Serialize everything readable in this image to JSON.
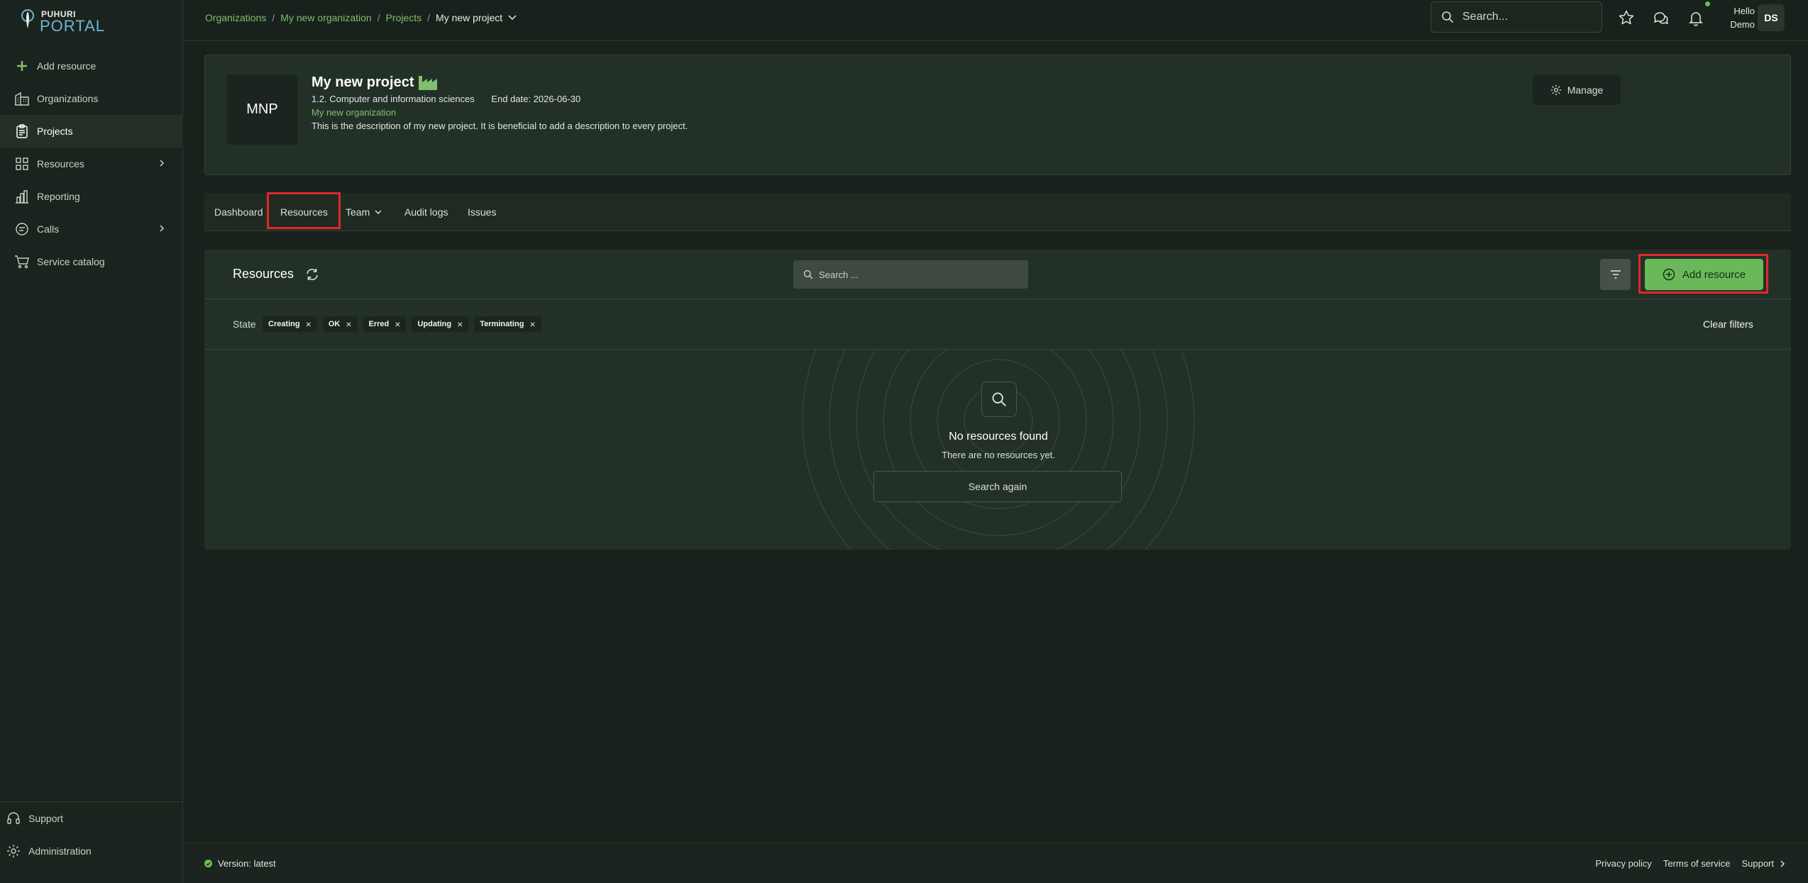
{
  "brand": {
    "top": "PUHURI",
    "bottom": "PORTAL"
  },
  "sidebar": {
    "items": [
      {
        "label": "Add resource",
        "icon": "plus-icon"
      },
      {
        "label": "Organizations",
        "icon": "building-icon"
      },
      {
        "label": "Projects",
        "icon": "clipboard-icon",
        "active": true
      },
      {
        "label": "Resources",
        "icon": "grid-icon",
        "has_chevron": true
      },
      {
        "label": "Reporting",
        "icon": "bar-chart-icon"
      },
      {
        "label": "Calls",
        "icon": "chat-icon",
        "has_chevron": true
      },
      {
        "label": "Service catalog",
        "icon": "cart-icon"
      }
    ],
    "bottom": [
      {
        "label": "Support",
        "icon": "headset-icon"
      },
      {
        "label": "Administration",
        "icon": "gear-icon"
      }
    ]
  },
  "topbar": {
    "breadcrumb": [
      "Organizations",
      "My new organization",
      "Projects"
    ],
    "breadcrumb_separator": "/",
    "current": "My new project",
    "search_placeholder": "Search...",
    "user": {
      "greeting": "Hello",
      "name": "Demo",
      "initials": "DS"
    }
  },
  "project": {
    "logo_text": "MNP",
    "title": "My new project",
    "discipline": "1.2. Computer and information sciences",
    "end_date": "End date: 2026-06-30",
    "organization": "My new organization",
    "description": "This is the description of my new project. It is beneficial to add a description to every project.",
    "manage_label": "Manage"
  },
  "tabs": [
    "Dashboard",
    "Resources",
    "Team",
    "Audit logs",
    "Issues"
  ],
  "resources": {
    "title": "Resources",
    "search_placeholder": "Search ...",
    "add_label": "Add resource",
    "state_label": "State",
    "chips": [
      "Creating",
      "OK",
      "Erred",
      "Updating",
      "Terminating"
    ],
    "chip_remove": "×",
    "clear_filters": "Clear filters",
    "empty_title": "No resources found",
    "empty_sub": "There are no resources yet.",
    "search_again": "Search again"
  },
  "footer": {
    "version": "Version: latest",
    "links": [
      "Privacy policy",
      "Terms of service",
      "Support"
    ]
  },
  "colors": {
    "accent": "#6ab85a",
    "link": "#7fbf6f",
    "highlight": "#e0282a",
    "background": "#18211b"
  }
}
